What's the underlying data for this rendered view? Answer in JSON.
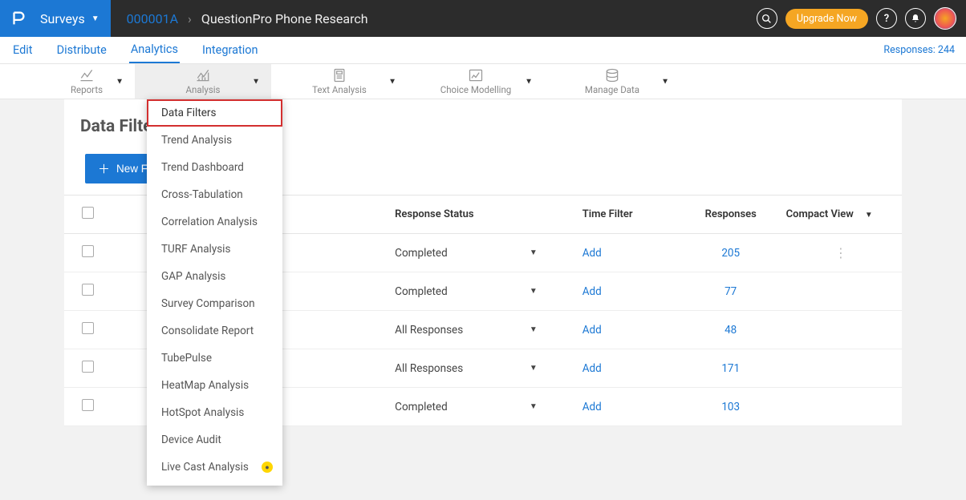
{
  "header": {
    "surveys_label": "Surveys",
    "survey_id": "000001A",
    "survey_name": "QuestionPro Phone Research",
    "upgrade": "Upgrade Now"
  },
  "nav": {
    "edit": "Edit",
    "distribute": "Distribute",
    "analytics": "Analytics",
    "integration": "Integration",
    "responses": "Responses: 244"
  },
  "toolbar": {
    "reports": "Reports",
    "analysis": "Analysis",
    "text_analysis": "Text Analysis",
    "choice_modelling": "Choice Modelling",
    "manage_data": "Manage Data"
  },
  "page": {
    "title": "Data Filter",
    "new_filter": "New Filter"
  },
  "table": {
    "headers": {
      "status": "Response Status",
      "time": "Time Filter",
      "responses": "Responses",
      "view": "Compact View"
    },
    "rows": [
      {
        "status": "Completed",
        "time": "Add",
        "responses": "205"
      },
      {
        "status": "Completed",
        "time": "Add",
        "responses": "77"
      },
      {
        "status": "All Responses",
        "time": "Add",
        "responses": "48"
      },
      {
        "status": "All Responses",
        "time": "Add",
        "responses": "171"
      },
      {
        "status": "Completed",
        "time": "Add",
        "responses": "103"
      }
    ]
  },
  "dropdown": {
    "items": [
      "Data Filters",
      "Trend Analysis",
      "Trend Dashboard",
      "Cross-Tabulation",
      "Correlation Analysis",
      "TURF Analysis",
      "GAP Analysis",
      "Survey Comparison",
      "Consolidate Report",
      "TubePulse",
      "HeatMap Analysis",
      "HotSpot Analysis",
      "Device Audit",
      "Live Cast Analysis"
    ]
  }
}
